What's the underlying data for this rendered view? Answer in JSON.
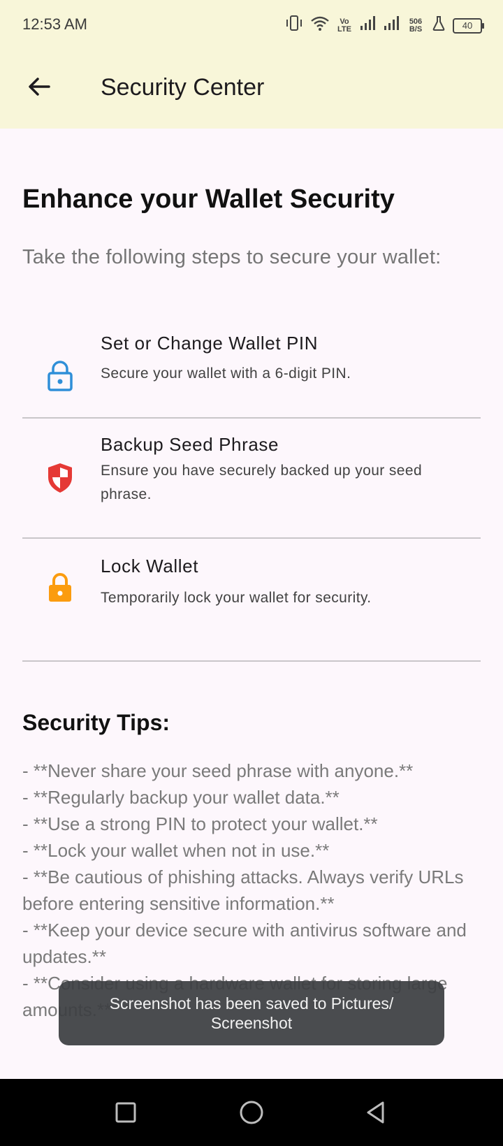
{
  "status_bar": {
    "time": "12:53 AM",
    "net_type": "Vo LTE",
    "data_speed": "506 B/S",
    "battery": "40",
    "icons": [
      "vibrate-icon",
      "wifi-icon",
      "volte-icon",
      "signal-icon",
      "signal-icon",
      "speed-icon",
      "lab-icon",
      "battery-icon"
    ]
  },
  "app_bar": {
    "back_icon": "arrow-left-icon",
    "title": "Security Center"
  },
  "main": {
    "heading": "Enhance your Wallet Security",
    "subtitle": "Take the following steps to secure your wallet:",
    "options": [
      {
        "title": "Set or Change Wallet PIN",
        "description": "Secure your wallet with a 6-digit PIN.",
        "icon": "lock-icon",
        "color": "#2f8fd8"
      },
      {
        "title": "Backup Seed Phrase",
        "description": "Ensure you have securely backed up your seed phrase.",
        "icon": "shield-icon",
        "color": "#e53935"
      },
      {
        "title": "Lock Wallet",
        "description": "Temporarily lock your wallet for security.",
        "icon": "lock-icon",
        "color": "#fb9c0f"
      }
    ],
    "tips_heading": "Security Tips:",
    "tips": [
      "- **Never share your seed phrase with anyone.**",
      "- **Regularly backup your wallet data.**",
      "- **Use a strong PIN to protect your wallet.**",
      "- **Lock your wallet when not in use.**",
      "- **Be cautious of phishing attacks. Always verify URLs before entering sensitive information.**",
      "- **Keep your device secure with antivirus software and updates.**",
      "- **Consider using a hardware wallet for storing large amounts.**"
    ]
  },
  "toast": {
    "message": "Screenshot has been saved to  Pictures/ Screenshot"
  },
  "nav_bar": {
    "icons": [
      "recents-icon",
      "home-icon",
      "back-icon"
    ]
  }
}
